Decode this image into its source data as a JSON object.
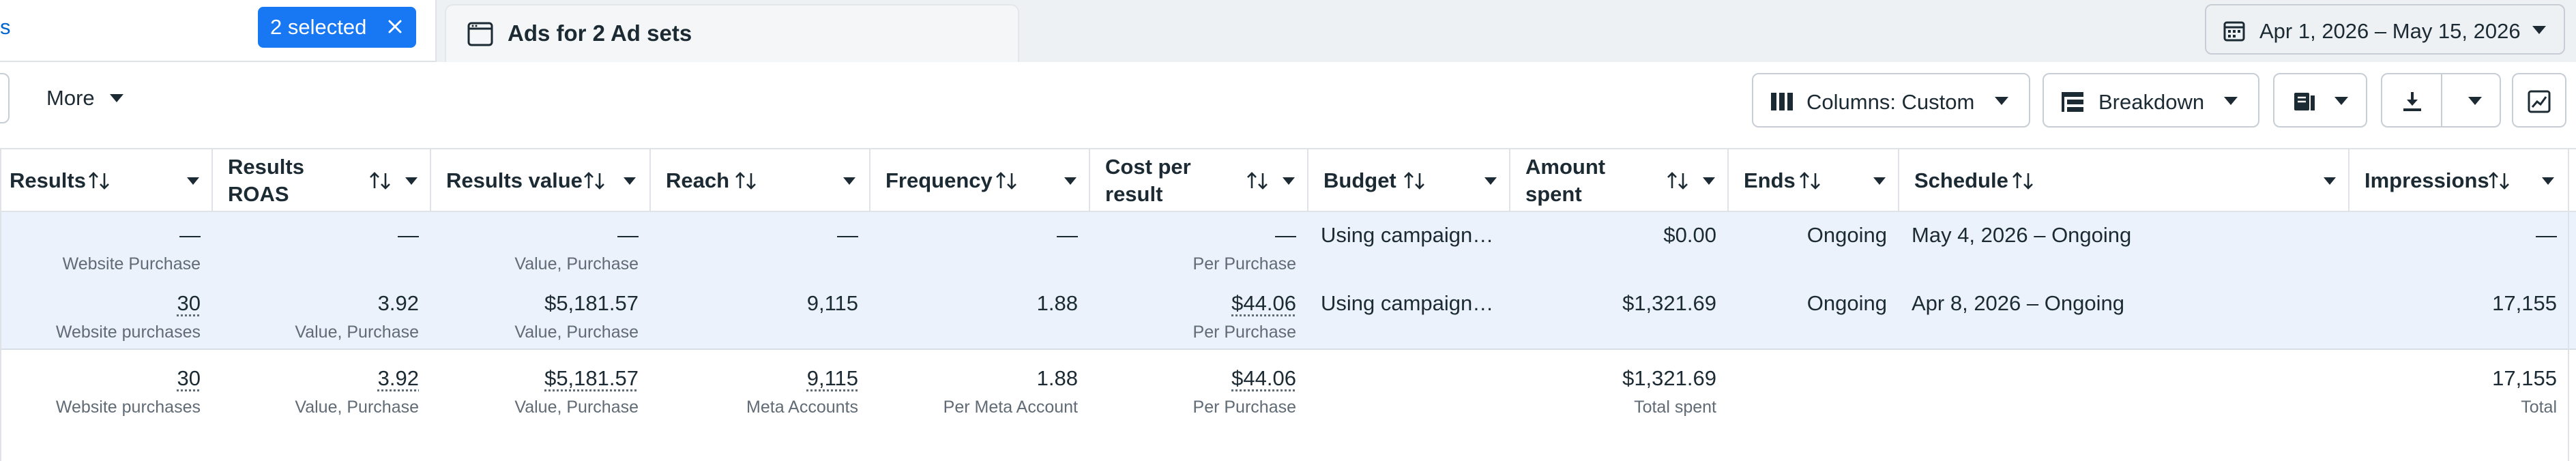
{
  "tabs": {
    "active_tab_label": "s",
    "selected_pill": "2 selected",
    "second_tab_label": "Ads for 2 Ad sets"
  },
  "date_range": "Apr 1, 2026 – May 15, 2026",
  "toolbar": {
    "more_label": "More",
    "columns_label": "Columns: Custom",
    "breakdown_label": "Breakdown"
  },
  "columns": [
    {
      "label": "Results"
    },
    {
      "label": "Results ROAS"
    },
    {
      "label": "Results value"
    },
    {
      "label": "Reach"
    },
    {
      "label": "Frequency"
    },
    {
      "label": "Cost per result"
    },
    {
      "label": "Budget"
    },
    {
      "label": "Amount spent"
    },
    {
      "label": "Ends"
    },
    {
      "label": "Schedule"
    },
    {
      "label": "Impressions"
    }
  ],
  "rows": [
    {
      "results": "—",
      "results_sub": "Website Purchase",
      "roas": "—",
      "roas_sub": "",
      "value": "—",
      "value_sub": "Value, Purchase",
      "reach": "—",
      "frequency": "—",
      "cpr": "—",
      "cpr_sub": "Per Purchase",
      "budget": "Using campaign…",
      "spent": "$0.00",
      "ends": "Ongoing",
      "schedule": "May 4, 2026 – Ongoing",
      "impressions": "—"
    },
    {
      "results": "30",
      "results_sub": "Website purchases",
      "roas": "3.92",
      "roas_sub": "Value, Purchase",
      "value": "$5,181.57",
      "value_sub": "Value, Purchase",
      "reach": "9,115",
      "frequency": "1.88",
      "cpr": "$44.06",
      "cpr_sub": "Per Purchase",
      "budget": "Using campaign…",
      "spent": "$1,321.69",
      "ends": "Ongoing",
      "schedule": "Apr 8, 2026 – Ongoing",
      "impressions": "17,155"
    }
  ],
  "totals": {
    "results": "30",
    "results_sub": "Website purchases",
    "roas": "3.92",
    "roas_sub": "Value, Purchase",
    "value": "$5,181.57",
    "value_sub": "Value, Purchase",
    "reach": "9,115",
    "reach_sub": "Meta Accounts",
    "frequency": "1.88",
    "frequency_sub": "Per Meta Account",
    "cpr": "$44.06",
    "cpr_sub": "Per Purchase",
    "spent": "$1,321.69",
    "spent_sub": "Total spent",
    "impressions": "17,155",
    "impressions_sub": "Total"
  },
  "colors": {
    "accent": "#1877f2",
    "link": "#0064d1",
    "selected_row_bg": "#ebf2fc",
    "text": "#1c2b33",
    "subtext": "#606b76"
  },
  "icons": [
    "close-icon",
    "ad-tab-icon",
    "calendar-icon",
    "columns-icon",
    "breakdown-icon",
    "reports-icon",
    "download-icon",
    "chart-icon",
    "sort-icon",
    "chevron-down-icon"
  ]
}
